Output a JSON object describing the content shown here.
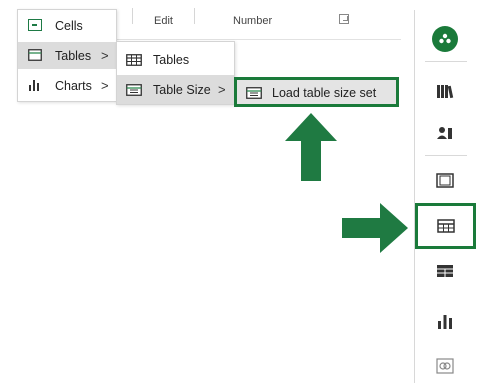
{
  "ribbon": {
    "group1_label": "Edit",
    "group2_label": "Number"
  },
  "menu1": {
    "items": [
      {
        "label": "Cells",
        "icon": "cells-icon"
      },
      {
        "label": "Tables",
        "icon": "table-icon",
        "chevron": ">"
      },
      {
        "label": "Charts",
        "icon": "bar-chart-icon",
        "chevron": ">"
      }
    ]
  },
  "menu2": {
    "items": [
      {
        "label": "Tables",
        "icon": "table-icon"
      },
      {
        "label": "Table Size",
        "icon": "table-size-icon",
        "chevron": ">"
      }
    ]
  },
  "menu3": {
    "items": [
      {
        "label": "Load table size set",
        "icon": "table-size-icon"
      }
    ]
  },
  "side_panel": {
    "buttons": [
      {
        "icon": "addin-logo-icon"
      },
      {
        "icon": "books-icon"
      },
      {
        "icon": "users-icon"
      },
      {
        "icon": "film-frame-icon"
      },
      {
        "icon": "table-grid-icon"
      },
      {
        "icon": "table-size-icon"
      },
      {
        "icon": "bar-chart-icon"
      },
      {
        "icon": "image-link-icon"
      }
    ]
  },
  "colors": {
    "accent_green": "#1a7a3a",
    "menu_highlight": "#dcdcdc"
  }
}
